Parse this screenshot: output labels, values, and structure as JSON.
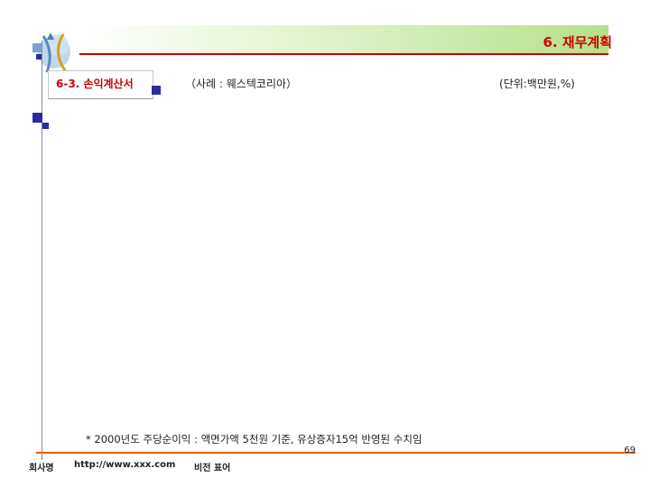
{
  "header": {
    "title": "6. 재무계획"
  },
  "section": {
    "title": "6-3. 손익계산서"
  },
  "labels": {
    "example": "（사례 : 웨스텍코리아）",
    "unit": "(단위:백만원,%)"
  },
  "footnote": "* 2000년도 주당순이익 : 액면가액 5천원 기준, 유상증자15억 반영된 수치임",
  "footer": {
    "page_number": "69",
    "company": "회사명",
    "url": "http://www.xxx.com",
    "confidential": "비전 표어"
  },
  "colors": {
    "accent": "#cc0000",
    "footer_rule": "#e06000",
    "marker": "#2c2ca0"
  }
}
